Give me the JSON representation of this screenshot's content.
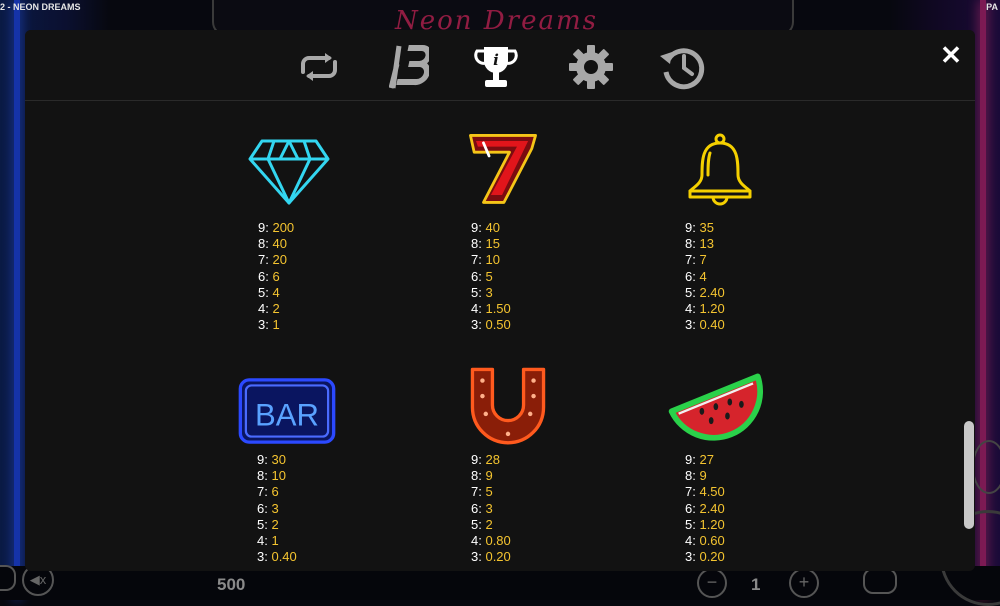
{
  "background": {
    "title_left": "2 - NEON DREAMS",
    "title_right": "PA",
    "logo_text": "Neon Dreams",
    "stake_value": "500",
    "lines_value": "1",
    "minus_label": "−",
    "plus_label": "+"
  },
  "header": {
    "tabs": [
      {
        "name": "autoplay",
        "icon": "repeat-icon",
        "active": false
      },
      {
        "name": "brand",
        "icon": "b-logo-icon",
        "active": false
      },
      {
        "name": "paytable",
        "icon": "trophy-info-icon",
        "active": true
      },
      {
        "name": "settings",
        "icon": "gear-icon",
        "active": false
      },
      {
        "name": "history",
        "icon": "history-icon",
        "active": false
      }
    ],
    "close_label": "✕"
  },
  "paytable": {
    "symbols": [
      {
        "name": "diamond",
        "icon": "diamond-icon",
        "payouts": [
          {
            "count": "9:",
            "value": "200"
          },
          {
            "count": "8:",
            "value": "40"
          },
          {
            "count": "7:",
            "value": "20"
          },
          {
            "count": "6:",
            "value": "6"
          },
          {
            "count": "5:",
            "value": "4"
          },
          {
            "count": "4:",
            "value": "2"
          },
          {
            "count": "3:",
            "value": "1"
          }
        ]
      },
      {
        "name": "seven",
        "icon": "seven-icon",
        "payouts": [
          {
            "count": "9:",
            "value": "40"
          },
          {
            "count": "8:",
            "value": "15"
          },
          {
            "count": "7:",
            "value": "10"
          },
          {
            "count": "6:",
            "value": "5"
          },
          {
            "count": "5:",
            "value": "3"
          },
          {
            "count": "4:",
            "value": "1.50"
          },
          {
            "count": "3:",
            "value": "0.50"
          }
        ]
      },
      {
        "name": "bell",
        "icon": "bell-icon",
        "payouts": [
          {
            "count": "9:",
            "value": "35"
          },
          {
            "count": "8:",
            "value": "13"
          },
          {
            "count": "7:",
            "value": "7"
          },
          {
            "count": "6:",
            "value": "4"
          },
          {
            "count": "5:",
            "value": "2.40"
          },
          {
            "count": "4:",
            "value": "1.20"
          },
          {
            "count": "3:",
            "value": "0.40"
          }
        ]
      },
      {
        "name": "bar",
        "icon": "bar-icon",
        "label": "BAR",
        "payouts": [
          {
            "count": "9:",
            "value": "30"
          },
          {
            "count": "8:",
            "value": "10"
          },
          {
            "count": "7:",
            "value": "6"
          },
          {
            "count": "6:",
            "value": "3"
          },
          {
            "count": "5:",
            "value": "2"
          },
          {
            "count": "4:",
            "value": "1"
          },
          {
            "count": "3:",
            "value": "0.40"
          }
        ]
      },
      {
        "name": "horseshoe",
        "icon": "horseshoe-icon",
        "payouts": [
          {
            "count": "9:",
            "value": "28"
          },
          {
            "count": "8:",
            "value": "9"
          },
          {
            "count": "7:",
            "value": "5"
          },
          {
            "count": "6:",
            "value": "3"
          },
          {
            "count": "5:",
            "value": "2"
          },
          {
            "count": "4:",
            "value": "0.80"
          },
          {
            "count": "3:",
            "value": "0.20"
          }
        ]
      },
      {
        "name": "watermelon",
        "icon": "watermelon-icon",
        "payouts": [
          {
            "count": "9:",
            "value": "27"
          },
          {
            "count": "8:",
            "value": "9"
          },
          {
            "count": "7:",
            "value": "4.50"
          },
          {
            "count": "6:",
            "value": "2.40"
          },
          {
            "count": "5:",
            "value": "1.20"
          },
          {
            "count": "4:",
            "value": "0.60"
          },
          {
            "count": "3:",
            "value": "0.20"
          }
        ]
      }
    ]
  },
  "colors": {
    "count_text": "#ffffff",
    "value_text": "#f4c430",
    "panel_bg": "#121212",
    "active_tab": "#ffffff",
    "inactive_tab": "#a8a8a8"
  }
}
